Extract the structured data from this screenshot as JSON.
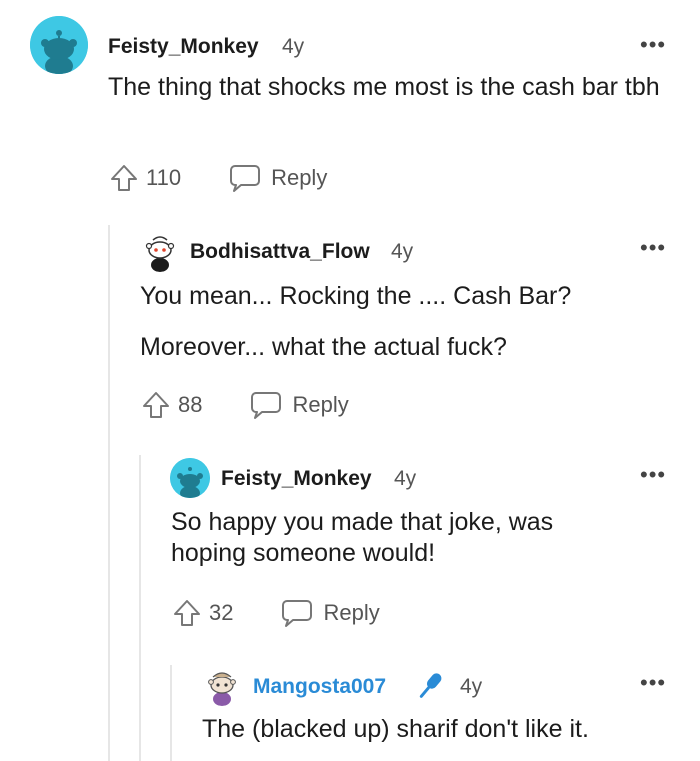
{
  "comments": [
    {
      "author": "Feisty_Monkey",
      "time": "4y",
      "paragraphs": [
        "The thing that shocks me most is the cash bar tbh"
      ],
      "votes": "110",
      "reply_label": "Reply",
      "avatar_color": "#3ec8e4"
    },
    {
      "author": "Bodhisattva_Flow",
      "time": "4y",
      "paragraphs": [
        "You mean... Rocking the .... Cash Bar?",
        "Moreover... what the actual fuck?"
      ],
      "votes": "88",
      "reply_label": "Reply"
    },
    {
      "author": "Feisty_Monkey",
      "time": "4y",
      "paragraphs": [
        "So happy you made that joke, was hoping someone would!"
      ],
      "votes": "32",
      "reply_label": "Reply",
      "avatar_color": "#3ec8e4"
    },
    {
      "author": "Mangosta007",
      "time": "4y",
      "paragraphs": [
        "The (blacked up) sharif don't like it."
      ],
      "author_color": "#2a8bd6",
      "flair_icon": "microphone-icon"
    }
  ],
  "more_options_icon": "more-options-icon"
}
